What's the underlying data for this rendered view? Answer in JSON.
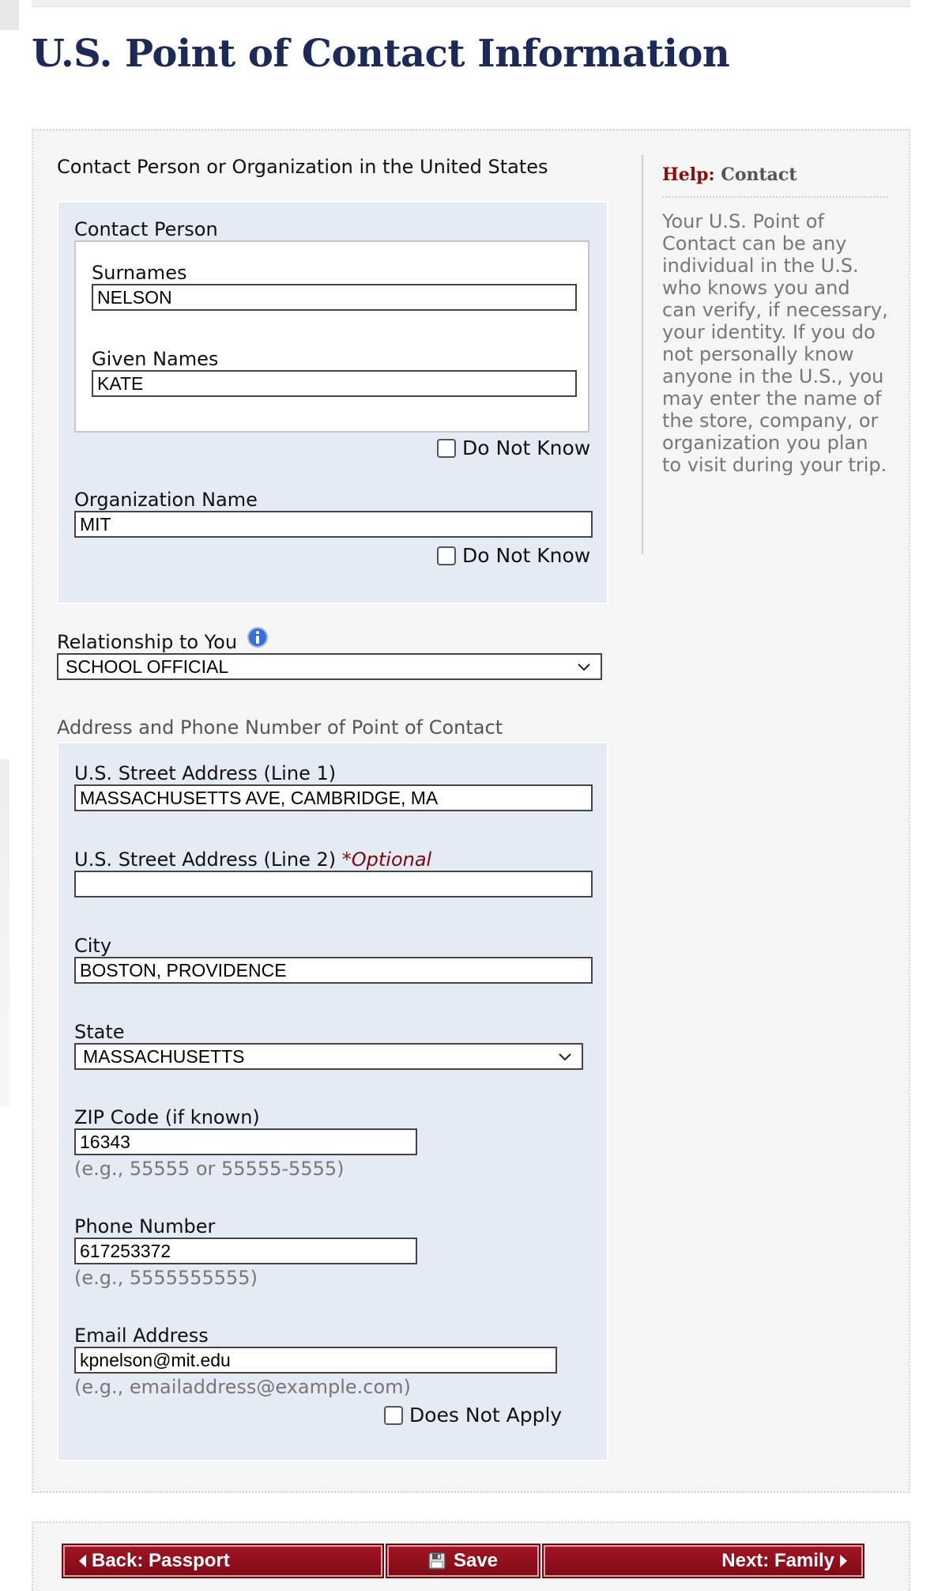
{
  "page": {
    "title": "U.S. Point of Contact Information"
  },
  "contact_section": {
    "heading": "Contact Person or Organization in the United States",
    "contact_person_label": "Contact Person",
    "surnames_label": "Surnames",
    "surnames_value": "NELSON",
    "given_names_label": "Given Names",
    "given_names_value": "KATE",
    "person_do_not_know_label": "Do Not Know",
    "organization_label": "Organization Name",
    "organization_value": "MIT",
    "org_do_not_know_label": "Do Not Know",
    "relationship_label": "Relationship to You",
    "relationship_value": "SCHOOL OFFICIAL",
    "info_icon": "info-icon"
  },
  "address_section": {
    "heading": "Address and Phone Number of Point of Contact",
    "street1_label": "U.S. Street Address (Line 1)",
    "street1_value": "MASSACHUSETTS AVE, CAMBRIDGE, MA",
    "street2_label": "U.S. Street Address (Line 2)",
    "street2_optional": "*Optional",
    "street2_value": "",
    "city_label": "City",
    "city_value": "BOSTON, PROVIDENCE",
    "state_label": "State",
    "state_value": "MASSACHUSETTS",
    "zip_label": "ZIP Code (if known)",
    "zip_value": "16343",
    "zip_hint": "(e.g., 55555 or 55555-5555)",
    "phone_label": "Phone Number",
    "phone_value": "617253372",
    "phone_hint": "(e.g., 5555555555)",
    "email_label": "Email Address",
    "email_value": "kpnelson@mit.edu",
    "email_hint": "(e.g., emailaddress@example.com)",
    "email_does_not_apply_label": "Does Not Apply"
  },
  "help": {
    "prefix": "Help:",
    "topic": "Contact",
    "text": "Your U.S. Point of Contact can be any individual in the U.S. who knows you and can verify, if necessary, your identity. If you do not personally know anyone in the U.S., you may enter the name of the store, company, or organization you plan to visit during your trip."
  },
  "navigation": {
    "back_label": "Back: Passport",
    "save_label": "Save",
    "next_label": "Next: Family"
  },
  "colors": {
    "title": "#1c2a57",
    "panel_blue": "#e4ebf5",
    "nav_red": "#8b0f1c",
    "help_accent": "#8b0a0a"
  }
}
